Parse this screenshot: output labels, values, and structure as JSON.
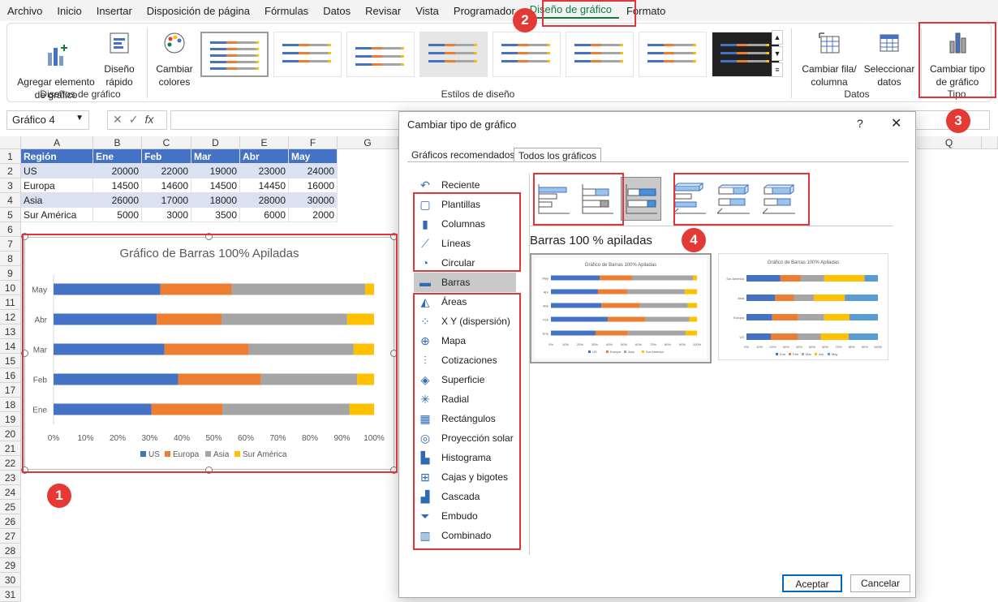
{
  "menu": [
    "Archivo",
    "Inicio",
    "Insertar",
    "Disposición de página",
    "Fórmulas",
    "Datos",
    "Revisar",
    "Vista",
    "Programador",
    "Diseño de gráfico",
    "Formato"
  ],
  "ribbon": {
    "add_element": "Agregar elemento\nde gráfico",
    "quick_layout": "Diseño\nrápido",
    "change_colors": "Cambiar\ncolores",
    "switch_row_col": "Cambiar fila/\ncolumna",
    "select_data": "Seleccionar\ndatos",
    "change_type": "Cambiar tipo\nde gráfico",
    "group_layouts": "Diseños de gráfico",
    "group_styles": "Estilos de diseño",
    "group_data": "Datos",
    "group_type": "Tipo"
  },
  "formula_bar": {
    "name_box": "Gráfico 4",
    "fx": "fx"
  },
  "columns": [
    "A",
    "B",
    "C",
    "D",
    "E",
    "F",
    "G"
  ],
  "column_q": "Q",
  "rows": [
    "1",
    "2",
    "3",
    "4",
    "5",
    "6",
    "7",
    "8",
    "9",
    "10",
    "11",
    "12",
    "13",
    "14",
    "15",
    "16",
    "17",
    "18",
    "19",
    "20",
    "21",
    "22",
    "23",
    "24",
    "25",
    "26",
    "27",
    "28",
    "29",
    "30",
    "31"
  ],
  "table": {
    "headers": [
      "Región",
      "Ene",
      "Feb",
      "Mar",
      "Abr",
      "May"
    ],
    "data": [
      [
        "US",
        "20000",
        "22000",
        "19000",
        "23000",
        "24000"
      ],
      [
        "Europa",
        "14500",
        "14600",
        "14500",
        "14450",
        "16000"
      ],
      [
        "Asia",
        "26000",
        "17000",
        "18000",
        "28000",
        "30000"
      ],
      [
        "Sur América",
        "5000",
        "3000",
        "3500",
        "6000",
        "2000"
      ]
    ]
  },
  "chart_data": {
    "type": "bar",
    "stacked": "100%",
    "orientation": "horizontal",
    "title": "Gráfico de Barras 100% Apiladas",
    "categories": [
      "May",
      "Abr",
      "Mar",
      "Feb",
      "Ene"
    ],
    "series": [
      {
        "name": "US",
        "color": "#4472c4",
        "values": [
          24000,
          23000,
          19000,
          22000,
          20000
        ]
      },
      {
        "name": "Europa",
        "color": "#ed7d31",
        "values": [
          16000,
          14450,
          14500,
          14600,
          14500
        ]
      },
      {
        "name": "Asia",
        "color": "#a5a5a5",
        "values": [
          30000,
          28000,
          18000,
          17000,
          26000
        ]
      },
      {
        "name": "Sur América",
        "color": "#ffc000",
        "values": [
          2000,
          6000,
          3500,
          3000,
          5000
        ]
      }
    ],
    "x_ticks": [
      "0%",
      "10%",
      "20%",
      "30%",
      "40%",
      "50%",
      "60%",
      "70%",
      "80%",
      "90%",
      "100%"
    ],
    "xlim": [
      0,
      100
    ],
    "legend": "bottom",
    "grid": false
  },
  "badges": [
    "1",
    "2",
    "3",
    "4"
  ],
  "dialog": {
    "title": "Cambiar tipo de gráfico",
    "help": "?",
    "close": "✕",
    "tabs": [
      "Gráficos recomendados",
      "Todos los gráficos"
    ],
    "types": [
      "Reciente",
      "Plantillas",
      "Columnas",
      "Líneas",
      "Circular",
      "Barras",
      "Áreas",
      "X Y (dispersión)",
      "Mapa",
      "Cotizaciones",
      "Superficie",
      "Radial",
      "Rectángulos",
      "Proyección solar",
      "Histograma",
      "Cajas y bigotes",
      "Cascada",
      "Embudo",
      "Combinado"
    ],
    "preview_label": "Barras 100 % apiladas",
    "preview1_title": "Gráfico de Barras 100% Apiladas",
    "preview2_title": "Gráfico de Barras 100% Apiladas",
    "preview2_categories": [
      "Sur América",
      "Asia",
      "Europa",
      "US"
    ],
    "preview2_legend": [
      "Ene",
      "Feb",
      "Mar",
      "Abr",
      "May"
    ],
    "ok": "Aceptar",
    "cancel": "Cancelar"
  },
  "colors": {
    "accent": "#107c41",
    "red": "#e0353b",
    "blue": "#4472c4",
    "orange": "#ed7d31",
    "gray": "#a5a5a5",
    "yellow": "#ffc000"
  }
}
